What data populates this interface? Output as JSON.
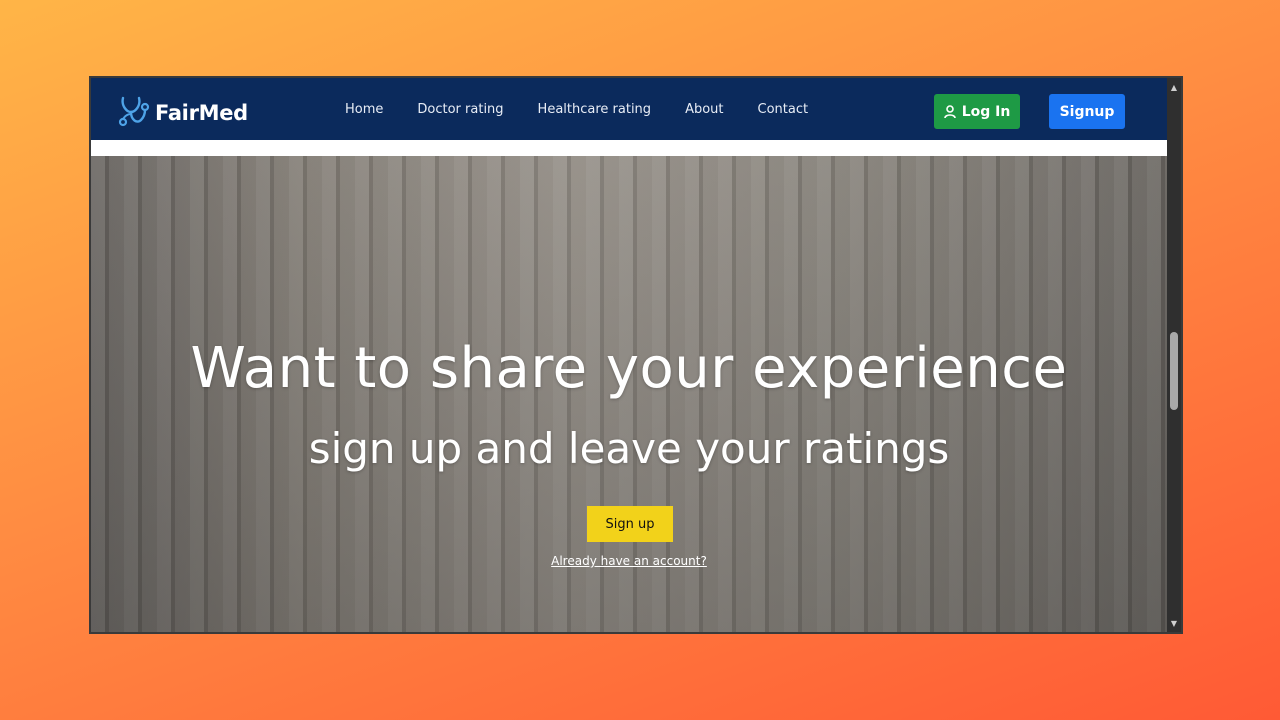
{
  "navbar": {
    "logo_text": "FairMed",
    "links": [
      "Home",
      "Doctor rating",
      "Healthcare rating",
      "About",
      "Contact"
    ],
    "login_label": "Log In",
    "signup_label": "Signup"
  },
  "hero": {
    "title": "Want to share your experience",
    "subtitle": "sign up and leave your ratings",
    "signup_button": "Sign up",
    "account_link": "Already have an account?"
  },
  "colors": {
    "navbar_bg": "#0b2a5c",
    "login_bg": "#1e9a45",
    "signup_bg": "#1a73f0",
    "hero_button_bg": "#f2d21a",
    "background_gradient": [
      "#ffb547",
      "#ff5a35"
    ]
  },
  "icons": {
    "logo": "stethoscope-icon",
    "login": "user-icon",
    "scroll_up": "arrow-up-icon",
    "scroll_down": "arrow-down-icon"
  }
}
